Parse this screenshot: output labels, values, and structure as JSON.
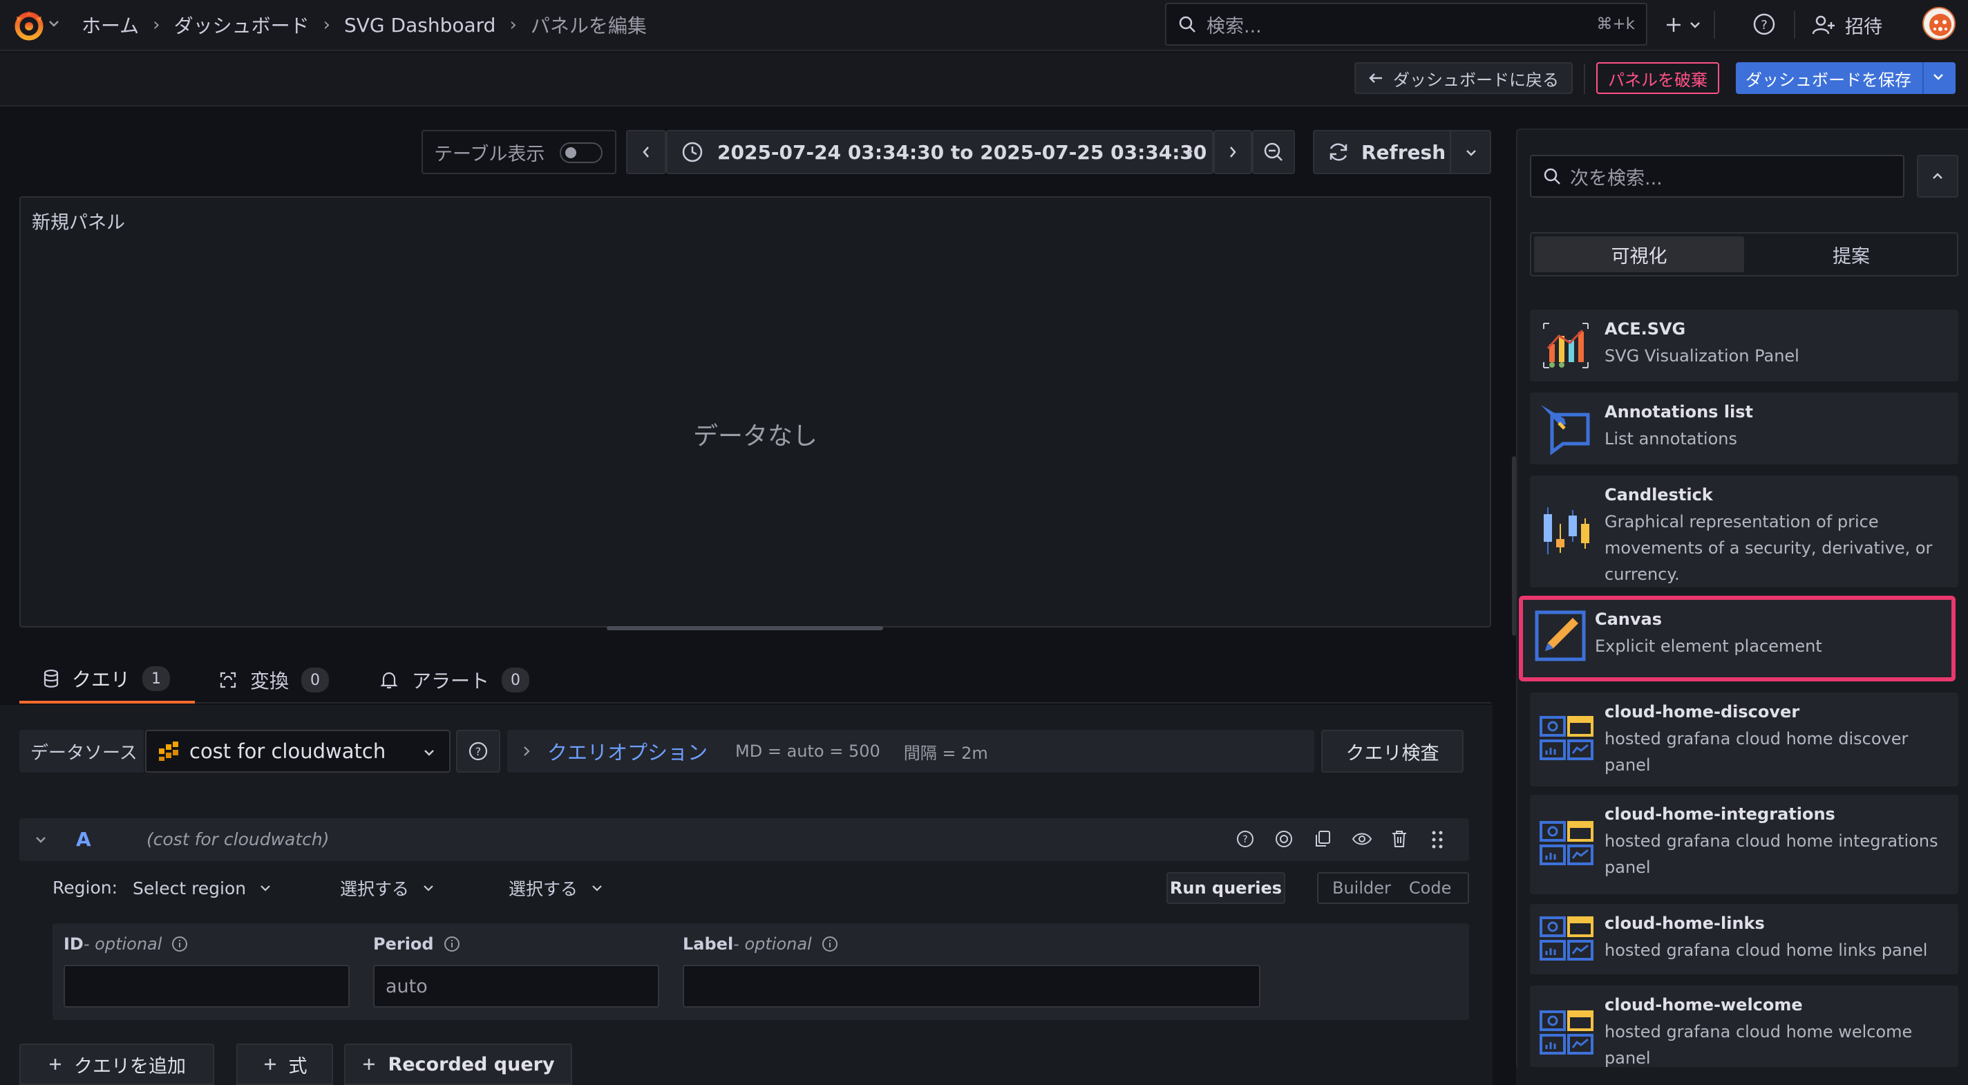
{
  "nav": {
    "breadcrumbs": [
      "ホーム",
      "ダッシュボード",
      "SVG Dashboard",
      "パネルを編集"
    ],
    "search_placeholder": "検索...",
    "search_shortcut": "⌘+k",
    "invite_label": "招待"
  },
  "toolbar": {
    "back_label": "ダッシュボードに戻る",
    "discard_label": "パネルを破棄",
    "save_label": "ダッシュボードを保存"
  },
  "panel_controls": {
    "table_view_label": "テーブル表示",
    "time_range": "2025-07-24 03:34:30 to 2025-07-25 03:34:30",
    "refresh_label": "Refresh"
  },
  "panel": {
    "title": "新規パネル",
    "no_data": "データなし"
  },
  "tabs": [
    {
      "label": "クエリ",
      "count": "1"
    },
    {
      "label": "変換",
      "count": "0"
    },
    {
      "label": "アラート",
      "count": "0"
    }
  ],
  "query": {
    "datasource_label": "データソース",
    "datasource_value": "cost for cloudwatch",
    "options_label": "クエリオプション",
    "md_info": "MD = auto = 500",
    "interval_info": "間隔 = 2m",
    "inspector_label": "クエリ検査",
    "row_letter": "A",
    "row_ds": "(cost for cloudwatch)",
    "region_label": "Region:",
    "region_value": "Select region",
    "select1": "選択する",
    "select2": "選択する",
    "run_label": "Run queries",
    "builder_label": "Builder",
    "code_label": "Code",
    "id_label": "ID",
    "id_suffix": " - optional",
    "period_label": "Period",
    "period_value": "auto",
    "label_label": "Label",
    "label_suffix": " - optional"
  },
  "bottom_buttons": {
    "add_query": "クエリを追加",
    "expression": "式",
    "recorded": "Recorded query"
  },
  "sidebar": {
    "search_placeholder": "次を検索...",
    "tab_viz": "可視化",
    "tab_suggest": "提案",
    "items": [
      {
        "title": "ACE.SVG",
        "desc": "SVG Visualization Panel",
        "icon": "ace-svg-icon"
      },
      {
        "title": "Annotations list",
        "desc": "List annotations",
        "icon": "annotations-list-icon"
      },
      {
        "title": "Candlestick",
        "desc": "Graphical representation of price movements of a security, derivative, or currency.",
        "icon": "candlestick-icon"
      },
      {
        "title": "Canvas",
        "desc": "Explicit element placement",
        "icon": "canvas-icon"
      },
      {
        "title": "cloud-home-discover",
        "desc": "hosted grafana cloud home discover panel",
        "icon": "cloud-home-icon"
      },
      {
        "title": "cloud-home-integrations",
        "desc": "hosted grafana cloud home integrations panel",
        "icon": "cloud-home-icon"
      },
      {
        "title": "cloud-home-links",
        "desc": "hosted grafana cloud home links panel",
        "icon": "cloud-home-icon"
      },
      {
        "title": "cloud-home-welcome",
        "desc": "hosted grafana cloud home welcome panel",
        "icon": "cloud-home-icon"
      }
    ]
  },
  "colors": {
    "accent_blue": "#3d71d9",
    "discard_red": "#ff5286",
    "highlight_pink": "#e8386d",
    "link_blue": "#6e9fff"
  }
}
